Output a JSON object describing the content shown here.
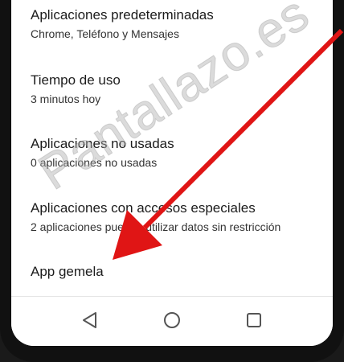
{
  "settings": {
    "items": [
      {
        "title": "Aplicaciones predeterminadas",
        "subtitle": "Chrome, Teléfono y Mensajes"
      },
      {
        "title": "Tiempo de uso",
        "subtitle": "3 minutos hoy"
      },
      {
        "title": "Aplicaciones no usadas",
        "subtitle": "0 aplicaciones no usadas"
      },
      {
        "title": "Aplicaciones con accesos especiales",
        "subtitle": "2 aplicaciones pueden utilizar datos sin restricción"
      },
      {
        "title": "App gemela"
      }
    ]
  },
  "nav": {
    "back_icon": "back-triangle-icon",
    "home_icon": "home-circle-icon",
    "recents_icon": "recents-square-icon"
  },
  "watermark": {
    "text": "Pantallazo.es"
  },
  "colors": {
    "arrow": "#e01515",
    "screen_bg": "#ffffff",
    "frame": "#111111",
    "text": "#1c1c1c"
  }
}
